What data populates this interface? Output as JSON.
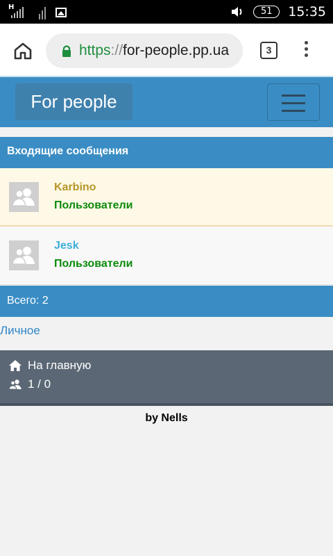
{
  "status_bar": {
    "network_type": "H",
    "battery": "51",
    "time": "15:35"
  },
  "browser": {
    "url_scheme": "https",
    "url_separator": "://",
    "url_host": "for-people.pp.ua",
    "tab_count": "3"
  },
  "navbar": {
    "brand": "For people"
  },
  "inbox": {
    "title": "Входящие сообщения",
    "messages": [
      {
        "name": "Karbino",
        "group": "Пользователи",
        "name_color": "#b6962a"
      },
      {
        "name": "Jesk",
        "group": "Пользователи",
        "name_color": "#3aaed9"
      }
    ],
    "total": "Всего: 2"
  },
  "links": {
    "personal": "Личное"
  },
  "footer_nav": {
    "home": "На главную",
    "online": "1 / 0"
  },
  "credit": "by Nells",
  "colors": {
    "primary": "#3a8dc4",
    "footer": "#5b6775",
    "group_green": "#0c8a0c",
    "link_blue": "#2e86c8"
  }
}
